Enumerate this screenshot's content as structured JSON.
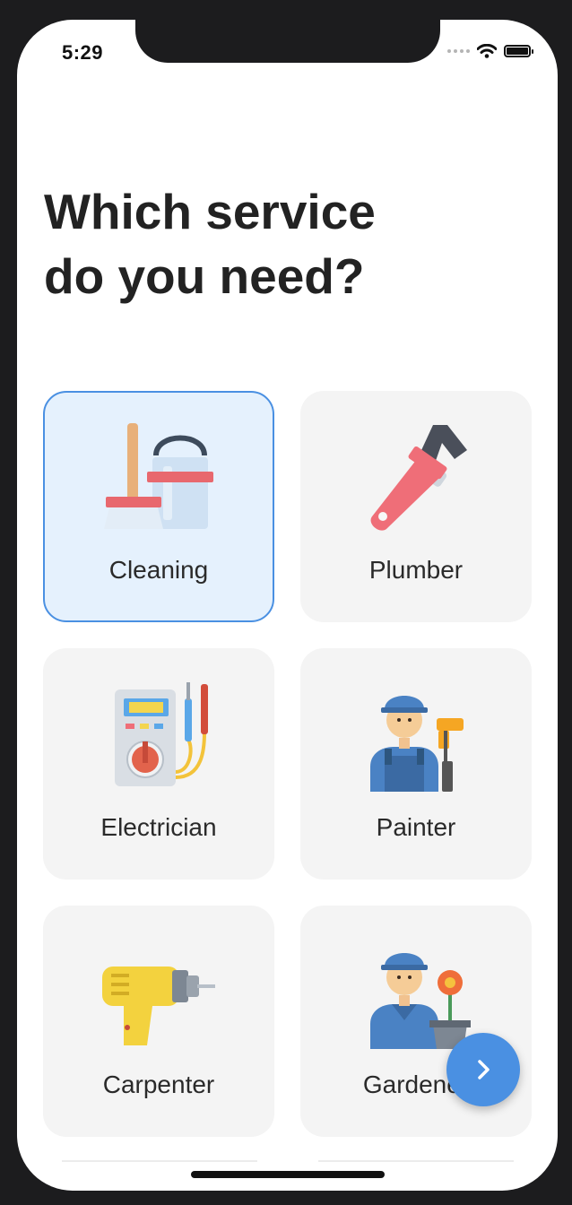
{
  "status_bar": {
    "time": "5:29"
  },
  "heading": "Which service\ndo you need?",
  "services": [
    {
      "label": "Cleaning",
      "icon": "cleaning-icon",
      "selected": true
    },
    {
      "label": "Plumber",
      "icon": "pipe-wrench-icon",
      "selected": false
    },
    {
      "label": "Electrician",
      "icon": "multimeter-icon",
      "selected": false
    },
    {
      "label": "Painter",
      "icon": "painter-icon",
      "selected": false
    },
    {
      "label": "Carpenter",
      "icon": "drill-icon",
      "selected": false
    },
    {
      "label": "Gardener",
      "icon": "gardener-icon",
      "selected": false
    }
  ],
  "next_button": {
    "icon": "chevron-right-icon"
  },
  "colors": {
    "accent": "#4a90e2",
    "selected_bg": "#e5f1fd",
    "card_bg": "#f4f4f4"
  }
}
